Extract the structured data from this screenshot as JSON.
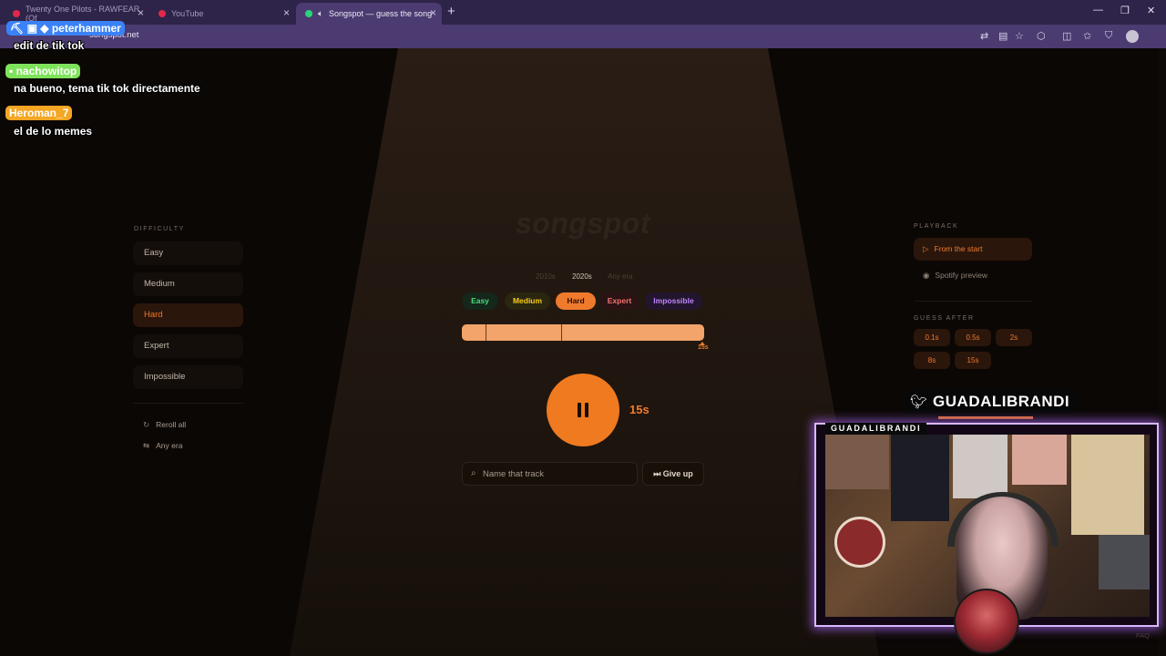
{
  "browser": {
    "tabs": [
      {
        "title": "Twenty One Pilots - RAWFEAR (Of",
        "active": false
      },
      {
        "title": "YouTube",
        "active": false
      },
      {
        "title": "Songspot — guess the song",
        "active": true
      }
    ],
    "url": "songspot.net"
  },
  "app": {
    "logo": "songspot",
    "difficulty_label": "DIFFICULTY",
    "difficulties": [
      {
        "label": "Easy",
        "selected": false
      },
      {
        "label": "Medium",
        "selected": false
      },
      {
        "label": "Hard",
        "selected": true
      },
      {
        "label": "Expert",
        "selected": false
      },
      {
        "label": "Impossible",
        "selected": false
      }
    ],
    "actions": {
      "reroll": "Reroll all",
      "any_era": "Any era"
    },
    "eras": [
      {
        "label": "2010s",
        "selected": false
      },
      {
        "label": "2020s",
        "selected": true
      },
      {
        "label": "Any era",
        "selected": false
      }
    ],
    "levels": [
      {
        "label": "Easy",
        "color": "#4ade80"
      },
      {
        "label": "Medium",
        "color": "#facc15"
      },
      {
        "label": "Hard",
        "color": "#f07a2c",
        "selected": true
      },
      {
        "label": "Expert",
        "color": "#f87171"
      },
      {
        "label": "Impossible",
        "color": "#c084fc"
      }
    ],
    "progress": {
      "fraction": 1.0,
      "end_label": "15s"
    },
    "player": {
      "time": "15s",
      "state": "playing"
    },
    "search": {
      "placeholder": "Name that track"
    },
    "give_up": "Give up",
    "playback_label": "PLAYBACK",
    "playback": [
      {
        "label": "From the start",
        "selected": true
      },
      {
        "label": "Spotify preview",
        "selected": false
      }
    ],
    "guess_after_label": "GUESS AFTER",
    "guess_after": [
      "0.1s",
      "0.5s",
      "2s",
      "8s",
      "15s"
    ],
    "faq": "FAQ"
  },
  "chat": [
    {
      "user": "peterhammer",
      "message": "edit de tik tok",
      "color": "#3b82f6"
    },
    {
      "user": "nachowitop",
      "message": "na bueno, tema tik tok directamente",
      "color": "#7ee35b"
    },
    {
      "user": "Heroman_7",
      "message": "el de lo memes",
      "color": "#f5a623"
    }
  ],
  "stream": {
    "twitter_handle": "GUADALIBRANDI",
    "cam_title": "GUADALIBRANDI"
  }
}
